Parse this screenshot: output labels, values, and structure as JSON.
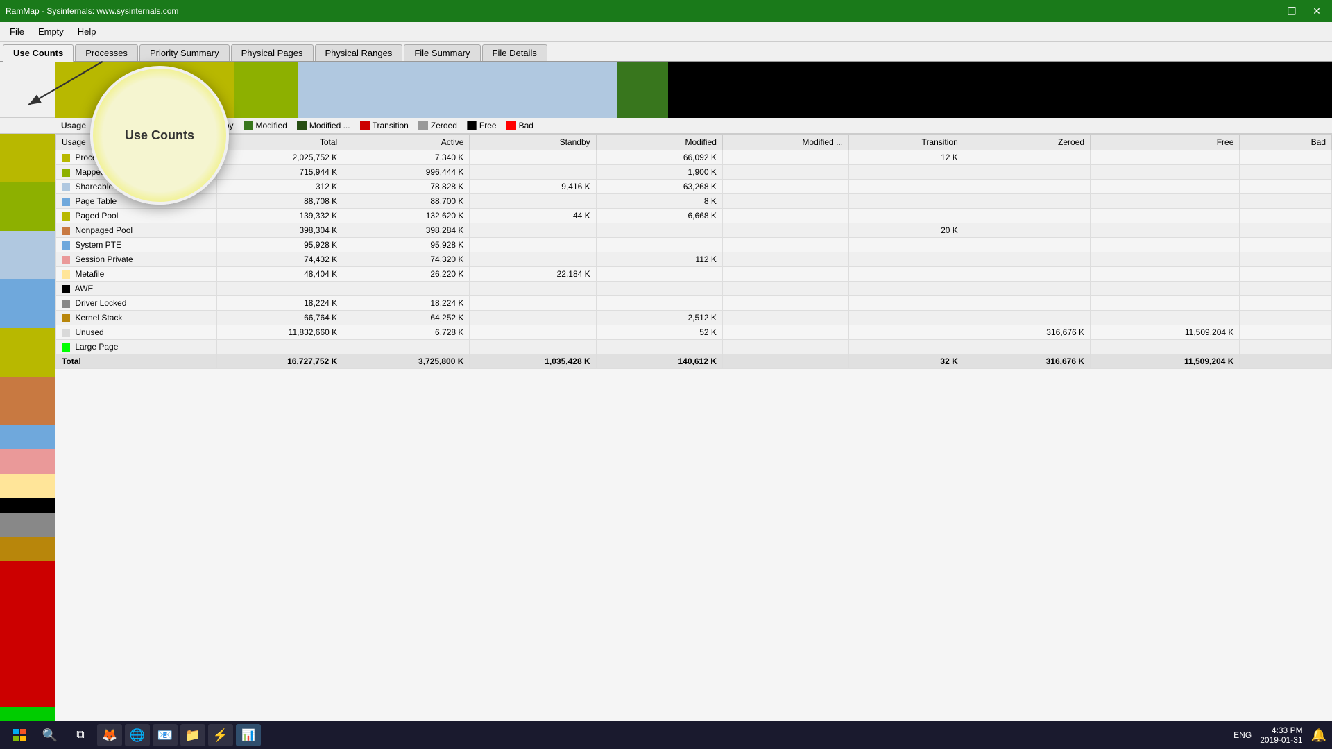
{
  "titleBar": {
    "title": "RamMap - Sysinternals: www.sysinternals.com",
    "minimize": "—",
    "maximize": "❐",
    "close": "✕"
  },
  "menuBar": {
    "items": [
      "File",
      "Empty",
      "Help"
    ]
  },
  "tabs": [
    {
      "label": "Use Counts",
      "active": true
    },
    {
      "label": "Processes",
      "active": false
    },
    {
      "label": "Priority Summary",
      "active": false
    },
    {
      "label": "Physical Pages",
      "active": false
    },
    {
      "label": "Physical Ranges",
      "active": false
    },
    {
      "label": "File Summary",
      "active": false
    },
    {
      "label": "File Details",
      "active": false
    }
  ],
  "legend": {
    "columns": [
      {
        "label": "Active",
        "color": "#8db000"
      },
      {
        "label": "Standby",
        "color": "#6fa8dc"
      },
      {
        "label": "Modified",
        "color": "#38761d"
      },
      {
        "label": "Modified ...",
        "color": "#274e13"
      },
      {
        "label": "Transition",
        "color": "#cc0000"
      },
      {
        "label": "Zeroed",
        "color": "#999999"
      },
      {
        "label": "Free",
        "color": "#000000"
      },
      {
        "label": "Bad",
        "color": "#ff0000"
      }
    ]
  },
  "tableHeaders": [
    "Usage",
    "Total",
    "Active",
    "Standby",
    "Modified",
    "Modified ...",
    "Transition",
    "Zeroed",
    "Free",
    "Bad"
  ],
  "tableRows": [
    {
      "name": "Process Private",
      "color": "#b8b800",
      "total": "2,025,752 K",
      "active": "7,340 K",
      "standby": "",
      "modified": "66,092 K",
      "modified2": "",
      "transition": "12 K",
      "zeroed": "",
      "free": "",
      "bad": ""
    },
    {
      "name": "Mapped File",
      "color": "#8db000",
      "total": "715,944 K",
      "active": "996,444 K",
      "standby": "",
      "modified": "1,900 K",
      "modified2": "",
      "transition": "",
      "zeroed": "",
      "free": "",
      "bad": ""
    },
    {
      "name": "Shareable",
      "color": "#b0c8e0",
      "total": "312 K",
      "active": "78,828 K",
      "standby": "9,416 K",
      "modified": "63,268 K",
      "modified2": "",
      "transition": "",
      "zeroed": "",
      "free": "",
      "bad": ""
    },
    {
      "name": "Page Table",
      "color": "#6fa8dc",
      "total": "88,708 K",
      "active": "88,700 K",
      "standby": "",
      "modified": "8 K",
      "modified2": "",
      "transition": "",
      "zeroed": "",
      "free": "",
      "bad": ""
    },
    {
      "name": "Paged Pool",
      "color": "#b8b800",
      "total": "139,332 K",
      "active": "132,620 K",
      "standby": "44 K",
      "modified": "6,668 K",
      "modified2": "",
      "transition": "",
      "zeroed": "",
      "free": "",
      "bad": ""
    },
    {
      "name": "Nonpaged Pool",
      "color": "#c87941",
      "total": "398,304 K",
      "active": "398,284 K",
      "standby": "",
      "modified": "",
      "modified2": "",
      "transition": "20 K",
      "zeroed": "",
      "free": "",
      "bad": ""
    },
    {
      "name": "System PTE",
      "color": "#6fa8dc",
      "total": "95,928 K",
      "active": "95,928 K",
      "standby": "",
      "modified": "",
      "modified2": "",
      "transition": "",
      "zeroed": "",
      "free": "",
      "bad": ""
    },
    {
      "name": "Session Private",
      "color": "#ea9999",
      "total": "74,432 K",
      "active": "74,320 K",
      "standby": "",
      "modified": "112 K",
      "modified2": "",
      "transition": "",
      "zeroed": "",
      "free": "",
      "bad": ""
    },
    {
      "name": "Metafile",
      "color": "#ffe599",
      "total": "48,404 K",
      "active": "26,220 K",
      "standby": "22,184 K",
      "modified": "",
      "modified2": "",
      "transition": "",
      "zeroed": "",
      "free": "",
      "bad": ""
    },
    {
      "name": "AWE",
      "color": "#000000",
      "total": "",
      "active": "",
      "standby": "",
      "modified": "",
      "modified2": "",
      "transition": "",
      "zeroed": "",
      "free": "",
      "bad": ""
    },
    {
      "name": "Driver Locked",
      "color": "#888888",
      "total": "18,224 K",
      "active": "18,224 K",
      "standby": "",
      "modified": "",
      "modified2": "",
      "transition": "",
      "zeroed": "",
      "free": "",
      "bad": ""
    },
    {
      "name": "Kernel Stack",
      "color": "#b8860b",
      "total": "66,764 K",
      "active": "64,252 K",
      "standby": "",
      "modified": "2,512 K",
      "modified2": "",
      "transition": "",
      "zeroed": "",
      "free": "",
      "bad": ""
    },
    {
      "name": "Unused",
      "color": "#d9d9d9",
      "total": "11,832,660 K",
      "active": "6,728 K",
      "standby": "",
      "modified": "52 K",
      "modified2": "",
      "transition": "",
      "zeroed": "316,676 K",
      "free": "11,509,204 K",
      "bad": ""
    },
    {
      "name": "Large Page",
      "color": "#00ff00",
      "total": "",
      "active": "",
      "standby": "",
      "modified": "",
      "modified2": "",
      "transition": "",
      "zeroed": "",
      "free": "",
      "bad": ""
    }
  ],
  "totalRow": {
    "name": "Total",
    "total": "16,727,752 K",
    "active": "3,725,800 K",
    "standby": "1,035,428 K",
    "modified": "140,612 K",
    "modified2": "",
    "transition": "32 K",
    "zeroed": "316,676 K",
    "free": "11,509,204 K",
    "bad": ""
  },
  "magnifier": {
    "text": "Use Counts"
  },
  "taskbar": {
    "time": "4:33 PM",
    "date": "2019-01-31",
    "lang": "ENG"
  },
  "chartBars": [
    {
      "color": "#b8b800",
      "width": 15
    },
    {
      "color": "#8db000",
      "width": 5
    },
    {
      "color": "#b0c8e0",
      "width": 25
    },
    {
      "color": "#38761d",
      "width": 3
    },
    {
      "color": "#000000",
      "width": 52
    }
  ],
  "sidebarColors": [
    "#b8b800",
    "#b8b800",
    "#b0c8e0",
    "#6fa8dc",
    "#b8b800",
    "#c87941",
    "#6fa8dc",
    "#ea9999",
    "#ffe599",
    "#000000",
    "#888888",
    "#b8860b",
    "#d9d9d9",
    "#00cc00"
  ]
}
